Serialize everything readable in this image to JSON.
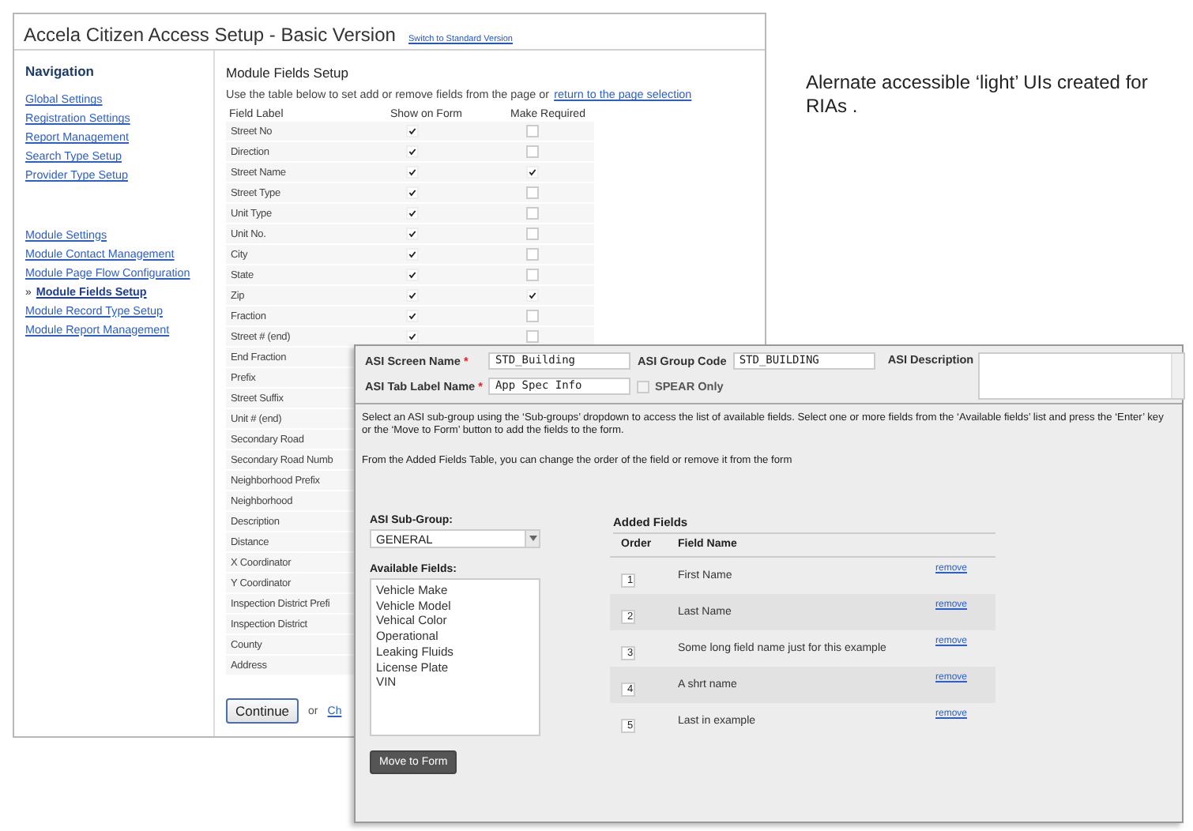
{
  "setup_window": {
    "title": "Accela Citizen Access Setup - Basic Version",
    "switch_link": "Switch to Standard Version"
  },
  "navigation": {
    "heading": "Navigation",
    "current_marker": "»",
    "groups": [
      [
        {
          "label": "Global Settings",
          "selected": false
        },
        {
          "label": "Registration Settings",
          "selected": false
        },
        {
          "label": "Report Management",
          "selected": false
        },
        {
          "label": "Search Type Setup",
          "selected": false
        },
        {
          "label": "Provider Type Setup",
          "selected": false
        }
      ],
      [
        {
          "label": "Module Settings",
          "selected": false
        },
        {
          "label": "Module Contact Management",
          "selected": false
        },
        {
          "label": "Module Page Flow Configuration",
          "selected": false
        },
        {
          "label": "Module Fields Setup",
          "selected": true
        },
        {
          "label": "Module Record Type Setup",
          "selected": false
        },
        {
          "label": "Module Report Management",
          "selected": false
        }
      ]
    ]
  },
  "module_fields": {
    "title": "Module Fields Setup",
    "intro": "Use the table below to set add or remove fields from the page or",
    "intro_link": "return to the page selection",
    "columns": [
      "Field Label",
      "Show on Form",
      "Make Required"
    ],
    "rows": [
      {
        "label": "Street No",
        "show_on_form": true,
        "make_required": false
      },
      {
        "label": "Direction",
        "show_on_form": true,
        "make_required": false
      },
      {
        "label": "Street Name",
        "show_on_form": true,
        "make_required": true
      },
      {
        "label": "Street Type",
        "show_on_form": true,
        "make_required": false
      },
      {
        "label": "Unit Type",
        "show_on_form": true,
        "make_required": false
      },
      {
        "label": "Unit No.",
        "show_on_form": true,
        "make_required": false
      },
      {
        "label": "City",
        "show_on_form": true,
        "make_required": false
      },
      {
        "label": "State",
        "show_on_form": true,
        "make_required": false
      },
      {
        "label": "Zip",
        "show_on_form": true,
        "make_required": true
      },
      {
        "label": "Fraction",
        "show_on_form": true,
        "make_required": false
      },
      {
        "label": "Street # (end)",
        "show_on_form": true,
        "make_required": false
      }
    ],
    "rows_under_dialog": [
      "End Fraction",
      "Prefix",
      "Street Suffix",
      "Unit # (end)",
      "Secondary Road",
      "Secondary Road Numb",
      "Neighborhood Prefix",
      "Neighborhood",
      "Description",
      "Distance",
      "X Coordinator",
      "Y Coordinator",
      "Inspection District Prefi",
      "Inspection District",
      "County",
      "Address"
    ],
    "continue_button": "Continue",
    "or_text": "or",
    "cut_link": "Ch"
  },
  "asi_dialog": {
    "required_mark": "*",
    "fields": [
      {
        "label": "ASI Screen Name",
        "required": true,
        "value": "STD_Building"
      },
      {
        "label": "ASI Group Code",
        "required": false,
        "value": "STD_BUILDING"
      },
      {
        "label": "ASI Tab Label Name",
        "required": true,
        "value": "App Spec Info"
      }
    ],
    "spear_only": {
      "label": "SPEAR Only",
      "checked": false
    },
    "description_label": "ASI Description",
    "instructions": [
      "Select an ASI sub-group using the ‘Sub-groups’ dropdown to access the list of available fields. Select one or more fields from the ‘Available fields’ list and press the ‘Enter’ key or the ‘Move to Form’ button to add the fields to the form.",
      "From the Added Fields Table, you can change the order of the field or remove it from the form"
    ],
    "sub_group": {
      "label": "ASI Sub-Group:",
      "value": "GENERAL"
    },
    "available_fields": {
      "label": "Available Fields:",
      "items": [
        "Vehicle Make",
        "Vehicle Model",
        "Vehical Color",
        "Operational",
        "Leaking Fluids",
        "License Plate",
        "VIN"
      ]
    },
    "move_button": "Move to Form",
    "added_fields": {
      "title": "Added Fields",
      "columns": [
        "Order",
        "Field Name"
      ],
      "rows": [
        {
          "order": "1",
          "name": "First Name",
          "action": "remove"
        },
        {
          "order": "2",
          "name": "Last Name",
          "action": "remove"
        },
        {
          "order": "3",
          "name": "Some long field name just for this example",
          "action": "remove"
        },
        {
          "order": "4",
          "name": "A shrt name",
          "action": "remove"
        },
        {
          "order": "5",
          "name": "Last in example",
          "action": "remove"
        }
      ]
    }
  },
  "side_note": "Alernate accessible ‘light’ UIs created for RIAs ."
}
